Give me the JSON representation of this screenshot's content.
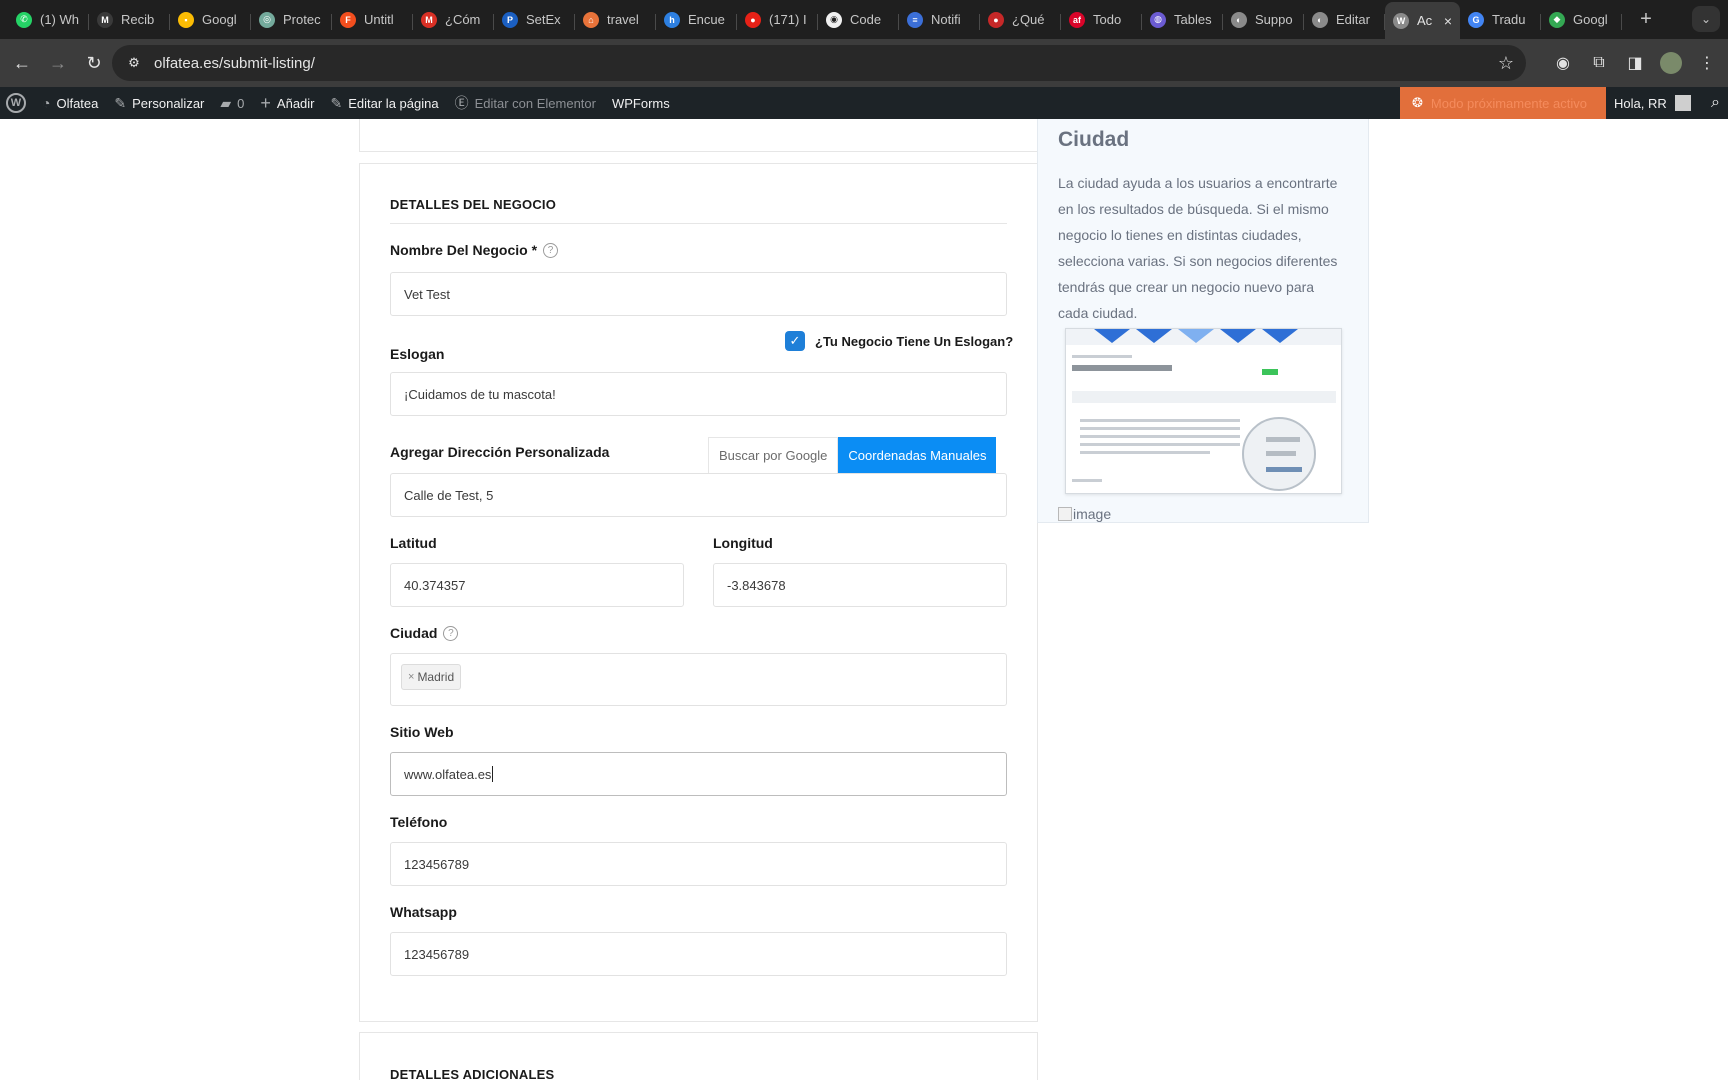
{
  "browser": {
    "tabs": [
      {
        "label": "(1) Wh",
        "icon": "whatsapp-icon",
        "color": "#25d366",
        "glyph": "✆"
      },
      {
        "label": "Recib",
        "icon": "gmail-icon",
        "color": "#3a3a3a",
        "glyph": "M"
      },
      {
        "label": "Googl",
        "icon": "keep-icon",
        "color": "#fbbc04",
        "glyph": "▪"
      },
      {
        "label": "Protec",
        "icon": "chatgpt-icon",
        "color": "#74aa9c",
        "glyph": "◎"
      },
      {
        "label": "Untitl",
        "icon": "figma-icon",
        "color": "#f24e1e",
        "glyph": "F"
      },
      {
        "label": "¿Cóm",
        "icon": "gmail-red-icon",
        "color": "#d93025",
        "glyph": "M"
      },
      {
        "label": "SetEx",
        "icon": "paypal-icon",
        "color": "#1b5fc1",
        "glyph": "P"
      },
      {
        "label": "travel",
        "icon": "travel-icon",
        "color": "#e8733a",
        "glyph": "⌂"
      },
      {
        "label": "Encue",
        "icon": "ho-icon",
        "color": "#2d7fe0",
        "glyph": "h"
      },
      {
        "label": "(171) I",
        "icon": "youtube-icon",
        "color": "#e62117",
        "glyph": "●"
      },
      {
        "label": "Code",
        "icon": "github-icon",
        "color": "#f0f0f0",
        "glyph": "◉"
      },
      {
        "label": "Notifi",
        "icon": "notif-icon",
        "color": "#3b6fd8",
        "glyph": "≡"
      },
      {
        "label": "¿Qué",
        "icon": "red-dot-icon",
        "color": "#c62828",
        "glyph": "●"
      },
      {
        "label": "Todo",
        "icon": "af-icon",
        "color": "#d90429",
        "glyph": "af"
      },
      {
        "label": "Tables",
        "icon": "tables-icon",
        "color": "#6b5bd2",
        "glyph": "◍"
      },
      {
        "label": "Suppo",
        "icon": "globe-icon",
        "color": "#8a8a8a",
        "glyph": "◐"
      },
      {
        "label": "Editar",
        "icon": "globe-icon",
        "color": "#8a8a8a",
        "glyph": "◐"
      },
      {
        "label": "Ac",
        "icon": "wp-icon",
        "color": "#8a8a8a",
        "glyph": "W",
        "active": true
      },
      {
        "label": "Tradu",
        "icon": "translate-icon",
        "color": "#4285f4",
        "glyph": "G"
      },
      {
        "label": "Googl",
        "icon": "maps-icon",
        "color": "#34a853",
        "glyph": "◆"
      }
    ],
    "url": "olfatea.es/submit-listing/"
  },
  "wpbar": {
    "site": "Olfatea",
    "customize": "Personalizar",
    "comments": "0",
    "add": "Añadir",
    "edit_page": "Editar la página",
    "elementor": "Editar con Elementor",
    "wpforms": "WPForms",
    "coming_soon": "Modo próximamente activo",
    "howdy": "Hola, RR"
  },
  "form": {
    "section_title": "DETALLES DEL NEGOCIO",
    "business_name_label": "Nombre Del Negocio *",
    "business_name_value": "Vet Test",
    "slogan_checkbox_label": "¿Tu Negocio Tiene Un Eslogan?",
    "slogan_label": "Eslogan",
    "slogan_value": "¡Cuidamos de tu mascota!",
    "address_label": "Agregar Dirección Personalizada",
    "address_mode_google": "Buscar por Google",
    "address_mode_manual": "Coordenadas Manuales",
    "address_value": "Calle de Test, 5",
    "lat_label": "Latitud",
    "lat_value": "40.374357",
    "lng_label": "Longitud",
    "lng_value": "-3.843678",
    "city_label": "Ciudad",
    "city_tag": "Madrid",
    "website_label": "Sitio Web",
    "website_value": "www.olfatea.es",
    "phone_label": "Teléfono",
    "phone_value": "123456789",
    "whatsapp_label": "Whatsapp",
    "whatsapp_value": "123456789",
    "next_section_title": "DETALLES ADICIONALES"
  },
  "help": {
    "title": "Ciudad",
    "text": "La ciudad ayuda a los usuarios a encontrarte en los resultados de búsqueda. Si el mismo negocio lo tienes en distintas ciudades, selecciona varias. Si son negocios diferentes tendrás que crear un negocio nuevo para cada ciudad.",
    "img_alt": "image"
  },
  "colors": {
    "accent": "#0b8df4",
    "checkbox": "#1e7fd8",
    "coming_soon": "#e26f3b"
  }
}
